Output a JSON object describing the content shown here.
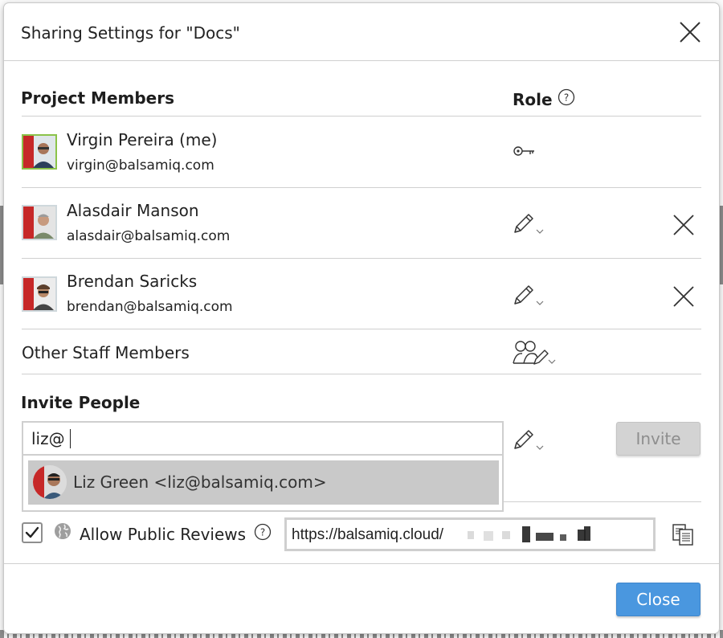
{
  "dialog": {
    "title": "Sharing Settings for \"Docs\""
  },
  "members_section": {
    "heading": "Project Members",
    "role_heading": "Role",
    "members": [
      {
        "name": "Virgin Pereira (me)",
        "email": "virgin@balsamiq.com",
        "role_icon": "key-icon",
        "removable": false
      },
      {
        "name": "Alasdair Manson",
        "email": "alasdair@balsamiq.com",
        "role_icon": "pencil-icon",
        "removable": true
      },
      {
        "name": "Brendan Saricks",
        "email": "brendan@balsamiq.com",
        "role_icon": "pencil-icon",
        "removable": true
      }
    ],
    "other_staff": {
      "label": "Other Staff Members",
      "role_icon": "group-pencil-icon"
    }
  },
  "invite": {
    "heading": "Invite People",
    "input_value": "liz@",
    "role_icon": "pencil-icon",
    "button_label": "Invite",
    "suggestion": "Liz Green <liz@balsamiq.com>"
  },
  "public_reviews": {
    "checked": true,
    "label": "Allow Public Reviews",
    "url": "https://balsamiq.cloud/"
  },
  "footer": {
    "close_label": "Close"
  },
  "colors": {
    "primary_button": "#4a97df",
    "disabled_button": "#d3d3d3",
    "me_border": "#8bc34a",
    "badge_red": "#c62828"
  }
}
